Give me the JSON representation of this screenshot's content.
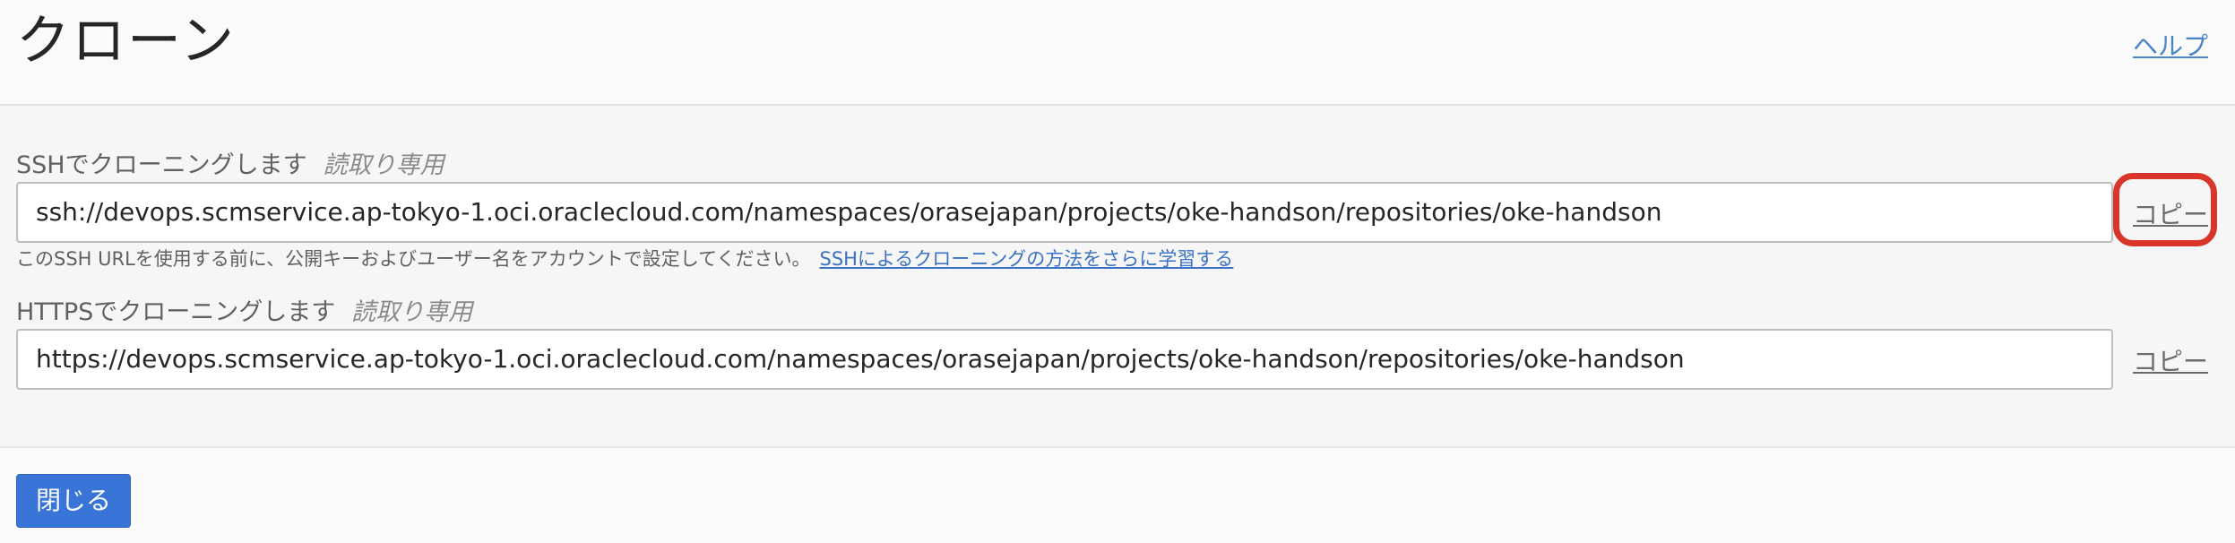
{
  "dialog": {
    "title": "クローン",
    "help_label": "ヘルプ"
  },
  "ssh": {
    "label": "SSHでクローニングします",
    "hint": "読取り専用",
    "url": "ssh://devops.scmservice.ap-tokyo-1.oci.oraclecloud.com/namespaces/orasejapan/projects/oke-handson/repositories/oke-handson",
    "copy_label": "コピー",
    "help_text": "このSSH URLを使用する前に、公開キーおよびユーザー名をアカウントで設定してください。",
    "help_link": "SSHによるクローニングの方法をさらに学習する"
  },
  "https": {
    "label": "HTTPSでクローニングします",
    "hint": "読取り専用",
    "url": "https://devops.scmservice.ap-tokyo-1.oci.oraclecloud.com/namespaces/orasejapan/projects/oke-handson/repositories/oke-handson",
    "copy_label": "コピー"
  },
  "footer": {
    "close_label": "閉じる"
  },
  "colors": {
    "primary_button": "#3875d7",
    "link": "#4a84c9",
    "highlight": "#d9352a"
  }
}
